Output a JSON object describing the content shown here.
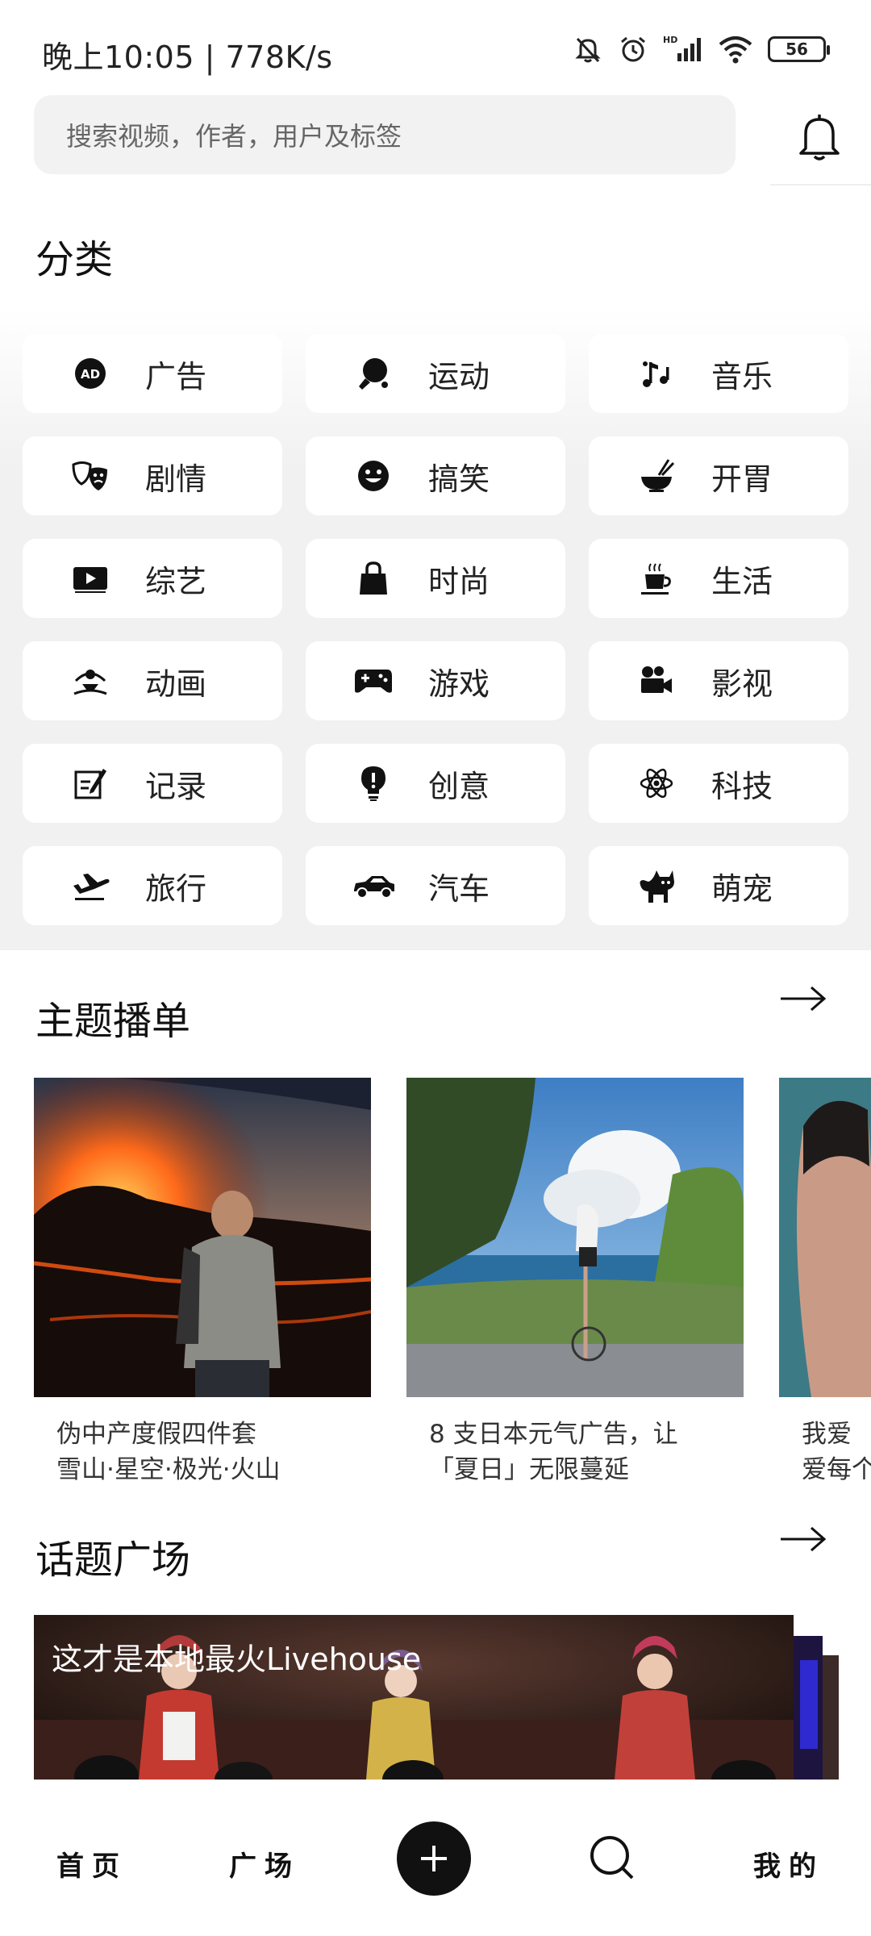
{
  "status_bar": {
    "time_speed": "晚上10:05 | 778K/s",
    "battery": "56"
  },
  "search": {
    "placeholder": "搜索视频，作者，用户及标签"
  },
  "category": {
    "title": "分类",
    "items": [
      {
        "label": "广告",
        "icon": "ad-icon"
      },
      {
        "label": "运动",
        "icon": "ping-pong-icon"
      },
      {
        "label": "音乐",
        "icon": "music-note-icon"
      },
      {
        "label": "剧情",
        "icon": "theater-masks-icon"
      },
      {
        "label": "搞笑",
        "icon": "smiley-icon"
      },
      {
        "label": "开胃",
        "icon": "bowl-icon"
      },
      {
        "label": "综艺",
        "icon": "tv-play-icon"
      },
      {
        "label": "时尚",
        "icon": "shopping-bag-icon"
      },
      {
        "label": "生活",
        "icon": "coffee-cup-icon"
      },
      {
        "label": "动画",
        "icon": "animation-icon"
      },
      {
        "label": "游戏",
        "icon": "gamepad-icon"
      },
      {
        "label": "影视",
        "icon": "movie-camera-icon"
      },
      {
        "label": "记录",
        "icon": "notebook-pen-icon"
      },
      {
        "label": "创意",
        "icon": "lightbulb-icon"
      },
      {
        "label": "科技",
        "icon": "atom-icon"
      },
      {
        "label": "旅行",
        "icon": "airplane-icon"
      },
      {
        "label": "汽车",
        "icon": "car-icon"
      },
      {
        "label": "萌宠",
        "icon": "cat-icon"
      }
    ]
  },
  "playlists": {
    "title": "主题播单",
    "cards": [
      {
        "line1": "伪中产度假四件套",
        "line2": "雪山·星空·极光·火山"
      },
      {
        "line1": "8 支日本元气广告，让",
        "line2": "「夏日」无限蔓延"
      },
      {
        "line1": "我爱",
        "line2": "爱每个"
      }
    ]
  },
  "topics": {
    "title": "话题广场",
    "card_title": "这才是本地最火Livehouse"
  },
  "bottom_nav": {
    "home": "首页",
    "square": "广场",
    "mine": "我的"
  }
}
